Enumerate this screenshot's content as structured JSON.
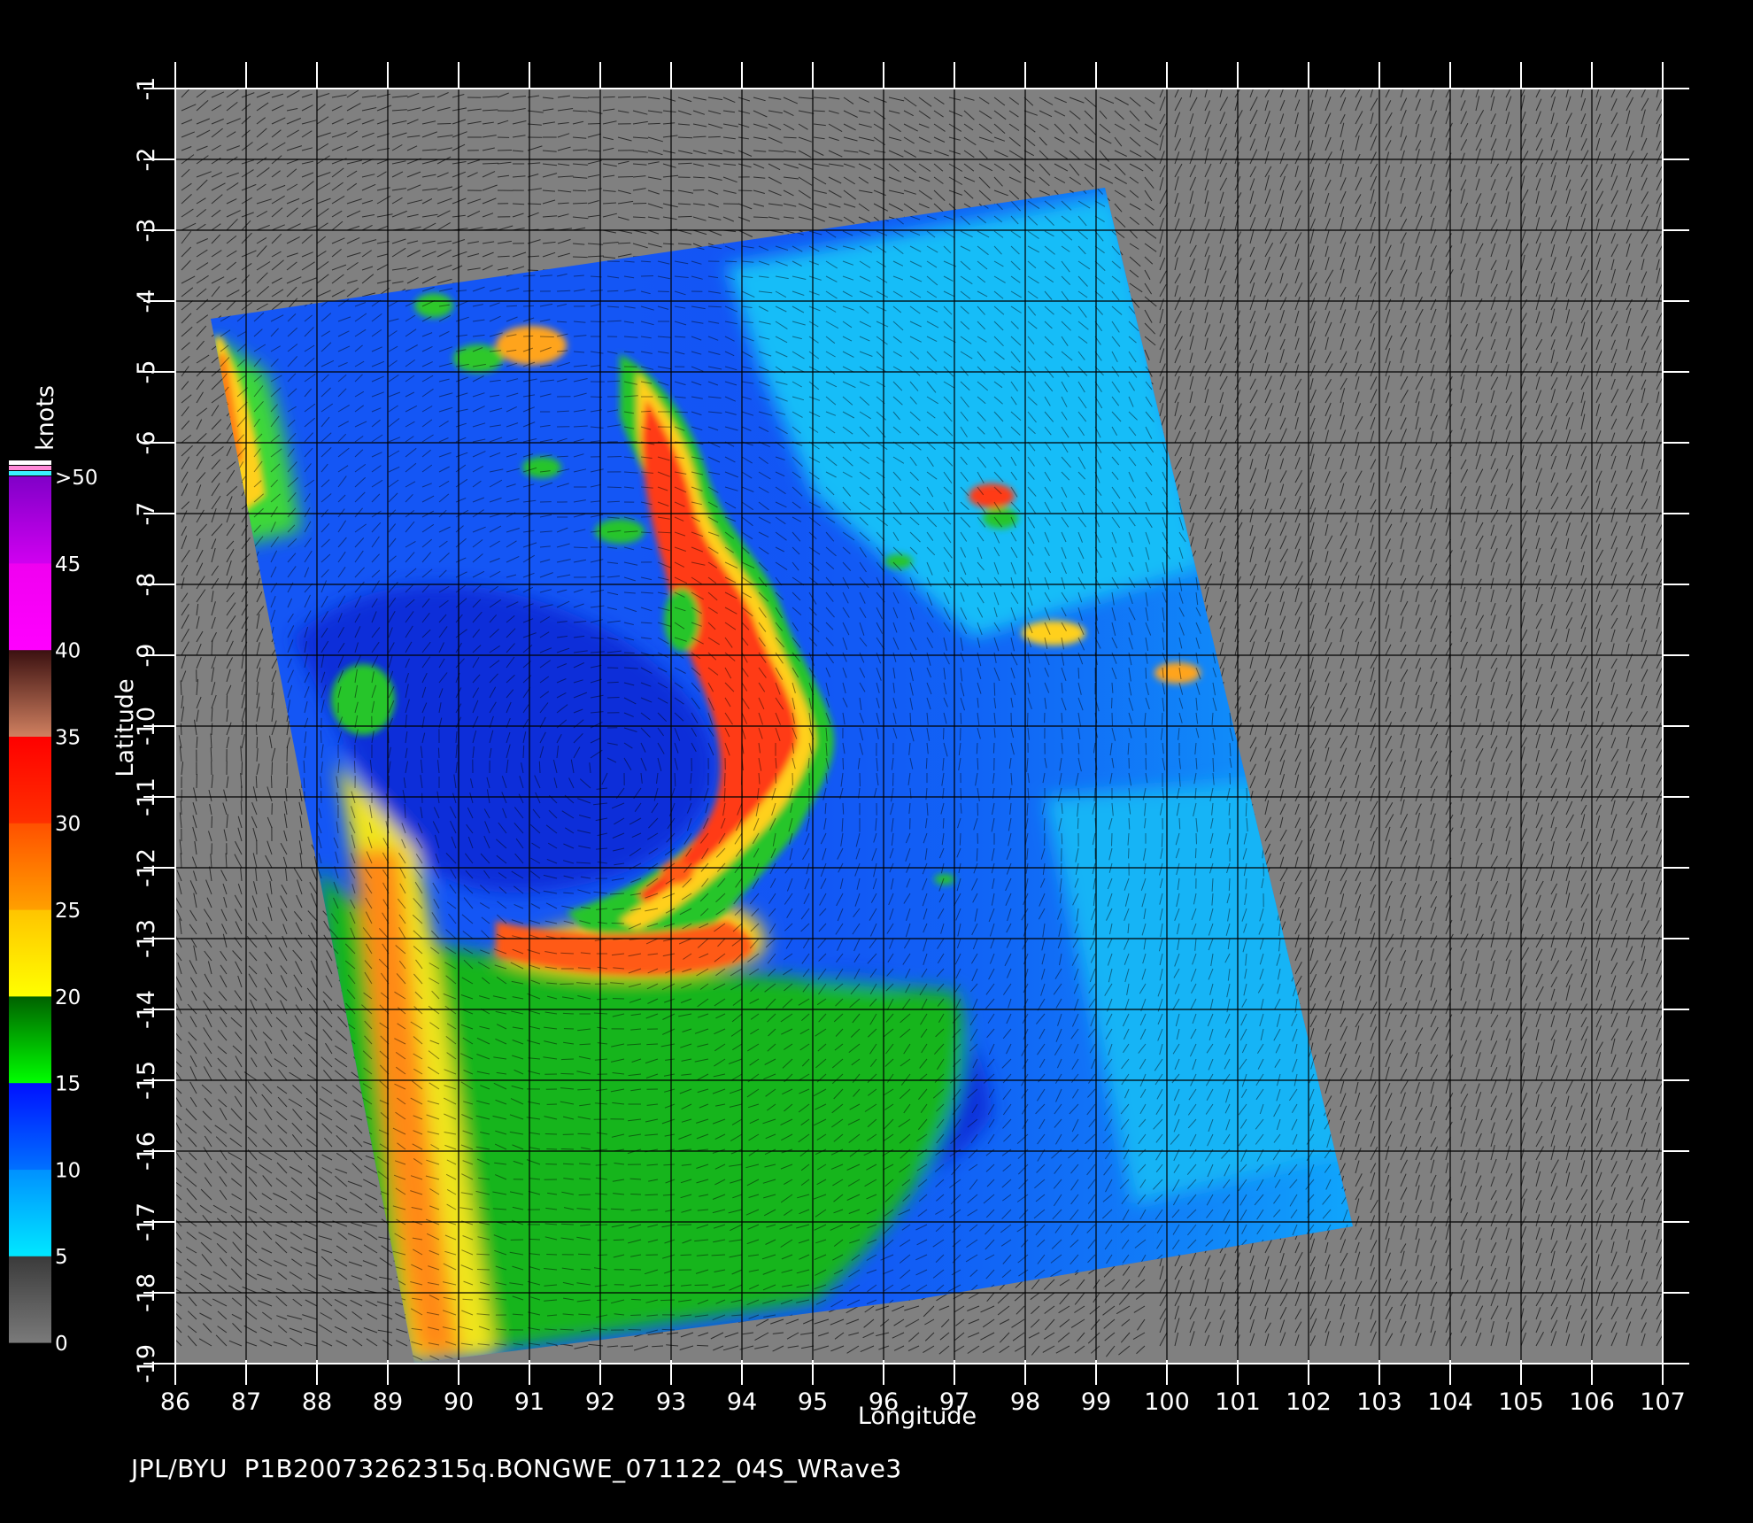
{
  "map": {
    "xlabel": "Longitude",
    "ylabel": "Latitude",
    "x_ticks": [
      "86",
      "87",
      "88",
      "89",
      "90",
      "91",
      "92",
      "93",
      "94",
      "95",
      "96",
      "97",
      "98",
      "99",
      "100",
      "101",
      "102",
      "103",
      "104",
      "105",
      "106",
      "107"
    ],
    "y_ticks": [
      "-1",
      "-2",
      "-3",
      "-4",
      "-5",
      "-6",
      "-7",
      "-8",
      "-9",
      "-10",
      "-11",
      "-12",
      "-13",
      "-14",
      "-15",
      "-16",
      "-17",
      "-18",
      "-19"
    ],
    "xlim": [
      86,
      107
    ],
    "ylim": [
      -19,
      -1
    ],
    "background_color": "#808080",
    "vector_color": "#000000",
    "high_wind_vector_color": "#ffffff"
  },
  "colorbar": {
    "title": "knots",
    "ticks": [
      "0",
      "5",
      "10",
      "15",
      "20",
      "25",
      "30",
      "35",
      "40",
      "45",
      ">50"
    ],
    "bands": [
      {
        "from": 0,
        "to": 5,
        "top": "#3a3a3a",
        "bottom": "#7a7a7a"
      },
      {
        "from": 5,
        "to": 10,
        "top": "#0090ff",
        "bottom": "#00e8ff"
      },
      {
        "from": 10,
        "to": 15,
        "top": "#0010ff",
        "bottom": "#0070ff"
      },
      {
        "from": 15,
        "to": 20,
        "top": "#006000",
        "bottom": "#00ff00"
      },
      {
        "from": 20,
        "to": 25,
        "top": "#ffc400",
        "bottom": "#ffff00"
      },
      {
        "from": 25,
        "to": 30,
        "top": "#ff5000",
        "bottom": "#ffa000"
      },
      {
        "from": 30,
        "to": 35,
        "top": "#ff0000",
        "bottom": "#ff3000"
      },
      {
        "from": 35,
        "to": 40,
        "top": "#3a1010",
        "bottom": "#d08060"
      },
      {
        "from": 40,
        "to": 45,
        "top": "#f000f0",
        "bottom": "#ff00ff"
      },
      {
        "from": 45,
        "to": 50,
        "top": "#8000c8",
        "bottom": "#d000f0"
      }
    ]
  },
  "footer_text": "JPL/BYU  P1B20073262315q.BONGWE_071122_04S_WRave3"
}
